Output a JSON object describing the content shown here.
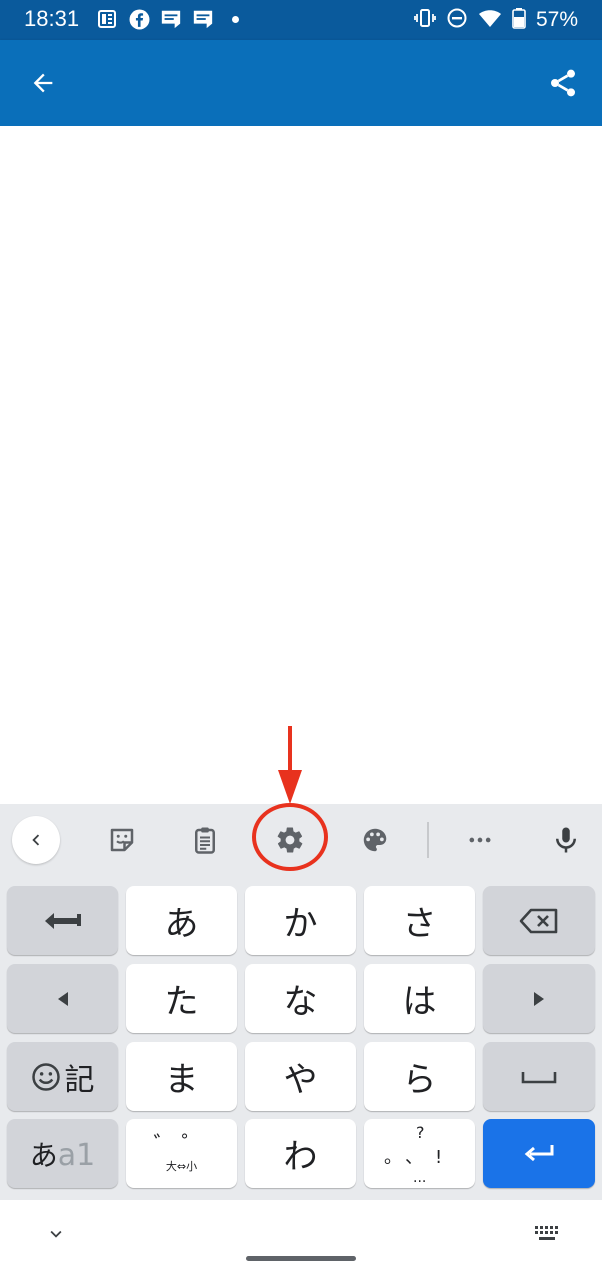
{
  "status_bar": {
    "time": "18:31",
    "notification_icons": [
      "news-icon",
      "facebook-icon",
      "line-manga-icon",
      "line-manga-icon",
      "dot-icon"
    ],
    "system_icons": [
      "vibrate-icon",
      "do-not-disturb-icon",
      "wifi-icon",
      "battery-icon"
    ],
    "battery": "57%"
  },
  "app_bar": {
    "color": "#0a6fba",
    "back_icon": "arrow-back-icon",
    "share_icon": "share-icon"
  },
  "keyboard": {
    "toolbar": [
      "collapse-icon",
      "sticker-icon",
      "clipboard-icon",
      "settings-icon",
      "palette-icon",
      "more-icon",
      "mic-icon"
    ],
    "rows": [
      [
        "←",
        "あ",
        "か",
        "さ",
        "⌫"
      ],
      [
        "◀",
        "た",
        "な",
        "は",
        "▶"
      ],
      [
        "☺記",
        "ま",
        "や",
        "ら",
        "space"
      ],
      [
        "あa1",
        "゛゜ 大⇔小",
        "わ",
        "、。?!",
        "enter"
      ]
    ],
    "keys": {
      "a": "あ",
      "ka": "か",
      "sa": "さ",
      "ta": "た",
      "na": "な",
      "ha": "は",
      "ma": "ま",
      "ya": "や",
      "ra": "ら",
      "wa": "わ",
      "emoji_suffix": "記",
      "mode_kana": "あ",
      "mode_latin": "a1",
      "dakuten_marks": "゛゜",
      "dakuten_sub": "大⇔小",
      "punct_top": "?",
      "punct_main": "。、!",
      "punct_bottom": "..."
    },
    "accent_color": "#1a73e8"
  },
  "annotation": {
    "color": "#e8321e",
    "target": "settings-icon"
  }
}
